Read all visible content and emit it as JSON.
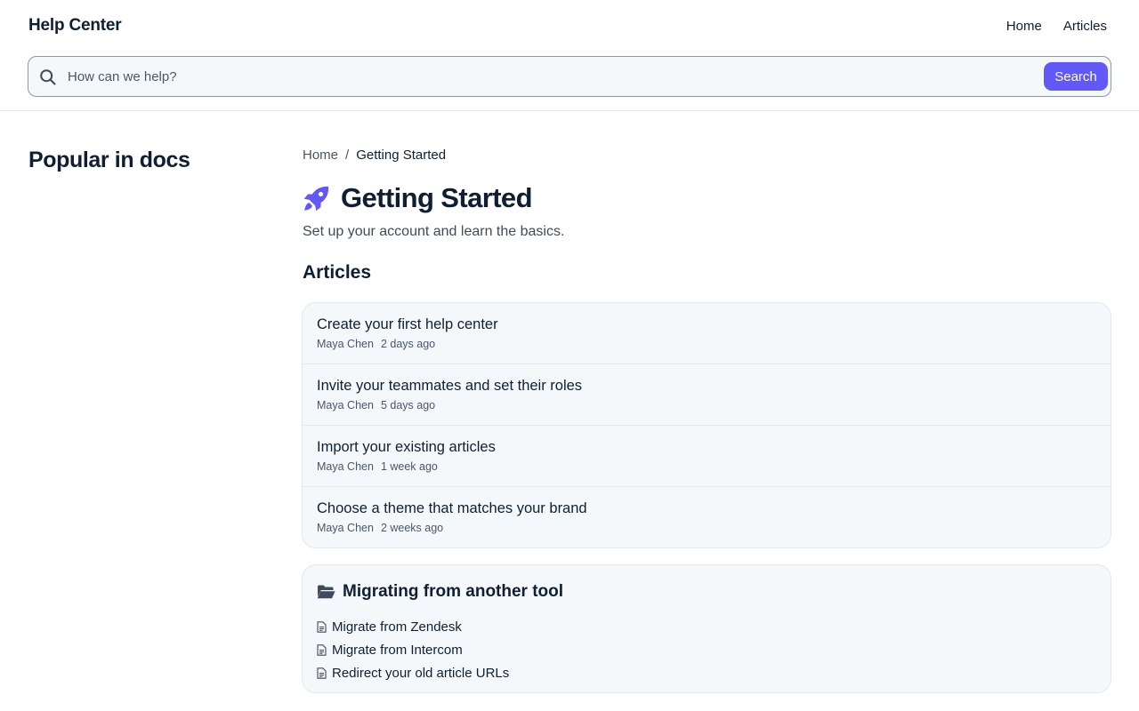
{
  "header": {
    "brand": "Help Center",
    "nav": [
      {
        "label": "Home"
      },
      {
        "label": "Articles"
      }
    ]
  },
  "search": {
    "placeholder": "How can we help?",
    "value": "",
    "button_label": "Search",
    "icon": "search-icon"
  },
  "sidebar": {
    "title": "Popular in docs"
  },
  "breadcrumb": {
    "items": [
      "Home",
      "Getting Started"
    ],
    "separator": "/"
  },
  "page": {
    "icon": "rocket-icon",
    "title": "Getting Started",
    "subtitle": "Set up your account and learn the basics.",
    "articles_heading": "Articles"
  },
  "articles": [
    {
      "title": "Create your first help center",
      "author": "Maya Chen",
      "time": "2 days ago"
    },
    {
      "title": "Invite your teammates and set their roles",
      "author": "Maya Chen",
      "time": "5 days ago"
    },
    {
      "title": "Import your existing articles",
      "author": "Maya Chen",
      "time": "1 week ago"
    },
    {
      "title": "Choose a theme that matches your brand",
      "author": "Maya Chen",
      "time": "2 weeks ago"
    }
  ],
  "collection": {
    "icon": "folder-open-icon",
    "title": "Migrating from another tool",
    "links": [
      {
        "label": "Migrate from Zendesk",
        "icon": "document-icon"
      },
      {
        "label": "Migrate from Intercom",
        "icon": "document-icon"
      },
      {
        "label": "Redirect your old article URLs",
        "icon": "document-icon"
      }
    ]
  },
  "colors": {
    "accent": "#6257f7",
    "text": "#0f1f33",
    "muted": "#4a5668",
    "card_bg": "#f5f8fb",
    "border": "#e3e8ee"
  }
}
